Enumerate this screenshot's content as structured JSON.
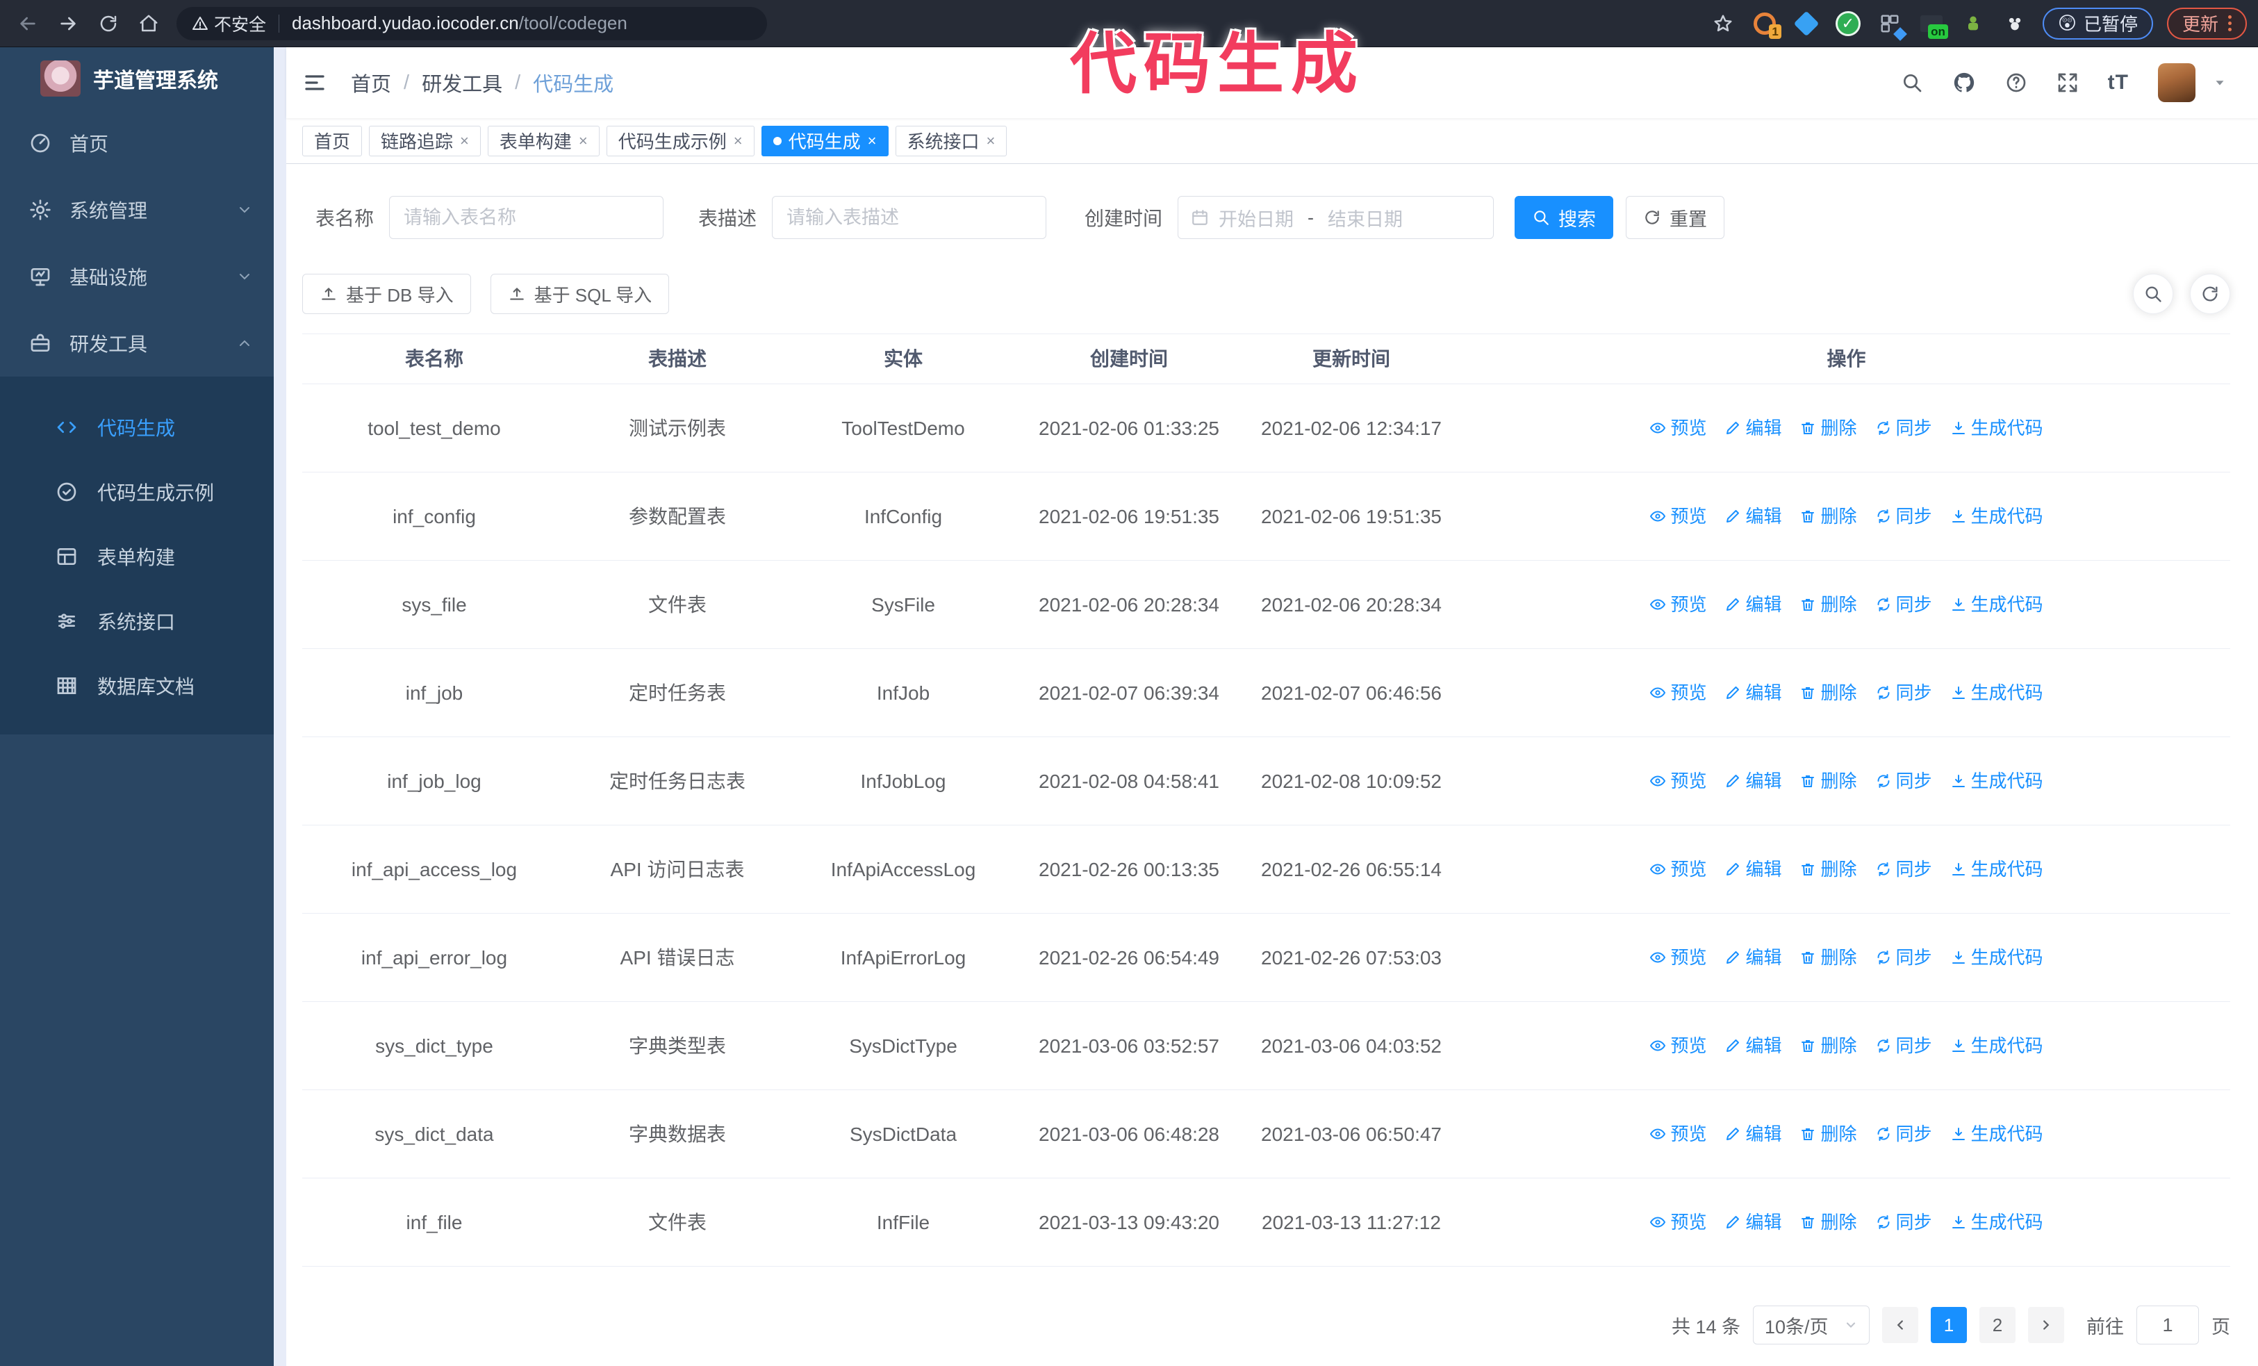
{
  "colors": {
    "accent": "#1890ff",
    "sidebar_bg": "#2a4663",
    "submenu_bg": "#1f3b57",
    "chrome_bg": "#262b36",
    "annotation": "#f23c5e"
  },
  "annotation": {
    "text": "代码生成"
  },
  "browser": {
    "security_label": "不安全",
    "url_host": "dashboard.yudao.iocoder.cn",
    "url_path": "/tool/codegen",
    "ext_badge_count": "1",
    "ext_badge_on": "on",
    "paused_emoji": "😲",
    "paused_label": "已暂停",
    "update_label": "更新"
  },
  "sidebar": {
    "title": "芋道管理系统",
    "menu": [
      {
        "label": "首页"
      },
      {
        "label": "系统管理"
      },
      {
        "label": "基础设施"
      },
      {
        "label": "研发工具"
      }
    ],
    "submenu": [
      {
        "label": "代码生成"
      },
      {
        "label": "代码生成示例"
      },
      {
        "label": "表单构建"
      },
      {
        "label": "系统接口"
      },
      {
        "label": "数据库文档"
      }
    ]
  },
  "header": {
    "breadcrumb": [
      "首页",
      "研发工具",
      "代码生成"
    ],
    "separator": "/",
    "font_size_icon_label": "tT"
  },
  "tags": [
    {
      "label": "首页"
    },
    {
      "label": "链路追踪"
    },
    {
      "label": "表单构建"
    },
    {
      "label": "代码生成示例"
    },
    {
      "label": "代码生成"
    },
    {
      "label": "系统接口"
    }
  ],
  "filters": {
    "table_name_label": "表名称",
    "table_name_placeholder": "请输入表名称",
    "table_desc_label": "表描述",
    "table_desc_placeholder": "请输入表描述",
    "create_time_label": "创建时间",
    "date_start_placeholder": "开始日期",
    "date_separator": "-",
    "date_end_placeholder": "结束日期",
    "search_label": "搜索",
    "reset_label": "重置"
  },
  "toolbar": {
    "import_db_label": "基于 DB 导入",
    "import_sql_label": "基于 SQL 导入"
  },
  "table": {
    "columns": [
      "表名称",
      "表描述",
      "实体",
      "创建时间",
      "更新时间",
      "操作"
    ],
    "actions": [
      "预览",
      "编辑",
      "删除",
      "同步",
      "生成代码"
    ],
    "rows": [
      [
        "tool_test_demo",
        "测试示例表",
        "ToolTestDemo",
        "2021-02-06 01:33:25",
        "2021-02-06 12:34:17"
      ],
      [
        "inf_config",
        "参数配置表",
        "InfConfig",
        "2021-02-06 19:51:35",
        "2021-02-06 19:51:35"
      ],
      [
        "sys_file",
        "文件表",
        "SysFile",
        "2021-02-06 20:28:34",
        "2021-02-06 20:28:34"
      ],
      [
        "inf_job",
        "定时任务表",
        "InfJob",
        "2021-02-07 06:39:34",
        "2021-02-07 06:46:56"
      ],
      [
        "inf_job_log",
        "定时任务日志表",
        "InfJobLog",
        "2021-02-08 04:58:41",
        "2021-02-08 10:09:52"
      ],
      [
        "inf_api_access_log",
        "API 访问日志表",
        "InfApiAccessLog",
        "2021-02-26 00:13:35",
        "2021-02-26 06:55:14"
      ],
      [
        "inf_api_error_log",
        "API 错误日志",
        "InfApiErrorLog",
        "2021-02-26 06:54:49",
        "2021-02-26 07:53:03"
      ],
      [
        "sys_dict_type",
        "字典类型表",
        "SysDictType",
        "2021-03-06 03:52:57",
        "2021-03-06 04:03:52"
      ],
      [
        "sys_dict_data",
        "字典数据表",
        "SysDictData",
        "2021-03-06 06:48:28",
        "2021-03-06 06:50:47"
      ],
      [
        "inf_file",
        "文件表",
        "InfFile",
        "2021-03-13 09:43:20",
        "2021-03-13 11:27:12"
      ]
    ]
  },
  "pagination": {
    "total": "共 14 条",
    "page_size": "10条/页",
    "pages": [
      "1",
      "2"
    ],
    "active_page": "1",
    "goto_label": "前往",
    "goto_value": "1",
    "page_suffix": "页"
  }
}
